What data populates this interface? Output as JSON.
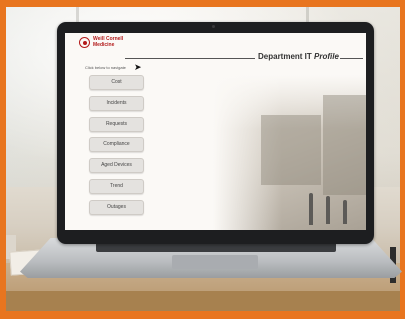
{
  "app": {
    "logo_line1": "Weill Cornell",
    "logo_line2": "Medicine",
    "title_main": "Department IT",
    "title_em": "Profile"
  },
  "hint": "Click below to navigate",
  "nav": {
    "items": [
      {
        "label": "Cost"
      },
      {
        "label": "Incidents"
      },
      {
        "label": "Requests"
      },
      {
        "label": "Compliance"
      },
      {
        "label": "Aged Devices"
      },
      {
        "label": "Trend"
      },
      {
        "label": "Outages"
      }
    ]
  },
  "icons": {
    "logo": "university-seal-icon",
    "pointer": "mouse-cursor-icon"
  },
  "colors": {
    "frame": "#e8751f",
    "brand_red": "#b31b1b",
    "button_bg": "#e4e2df"
  }
}
